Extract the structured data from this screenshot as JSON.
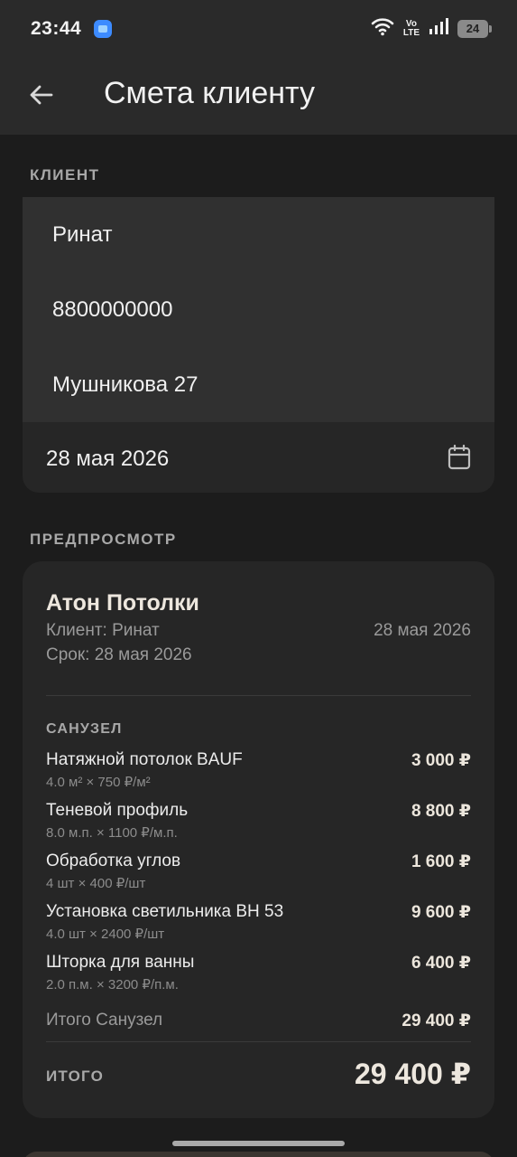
{
  "status_bar": {
    "time": "23:44",
    "network_label_top": "Vo",
    "network_label_bottom": "LTE",
    "battery": "24",
    "icons": [
      "app-notification-icon",
      "wifi-icon",
      "signal-icon",
      "battery-icon"
    ]
  },
  "app_bar": {
    "title": "Смета клиенту",
    "back_icon": "arrow-left-icon"
  },
  "client_section": {
    "label": "КЛИЕНТ",
    "name": "Ринат",
    "phone": "8800000000",
    "address": "Мушникова 27",
    "date": "28 мая 2026",
    "date_icon": "calendar-icon"
  },
  "preview_section": {
    "label": "ПРЕДПРОСМОТР",
    "company": "Атон Потолки",
    "client_line": "Клиент: Ринат",
    "date": "28 мая 2026",
    "deadline_line": "Срок: 28 мая 2026",
    "group": {
      "name": "САНУЗЕЛ",
      "items": [
        {
          "name": "Натяжной потолок BAUF",
          "detail": "4.0 м² × 750 ₽/м²",
          "price": "3 000 ₽"
        },
        {
          "name": "Теневой профиль",
          "detail": "8.0 м.п. × 1100 ₽/м.п.",
          "price": "8 800 ₽"
        },
        {
          "name": "Обработка углов",
          "detail": "4 шт × 400 ₽/шт",
          "price": "1 600 ₽"
        },
        {
          "name": "Установка светильника BH 53",
          "detail": "4.0 шт × 2400 ₽/шт",
          "price": "9 600 ₽"
        },
        {
          "name": "Шторка для ванны",
          "detail": "2.0 п.м. × 3200 ₽/п.м.",
          "price": "6 400 ₽"
        }
      ],
      "subtotal_label": "Итого Санузел",
      "subtotal_value": "29 400 ₽"
    },
    "total_label": "ИТОГО",
    "total_value": "29 400 ₽"
  }
}
